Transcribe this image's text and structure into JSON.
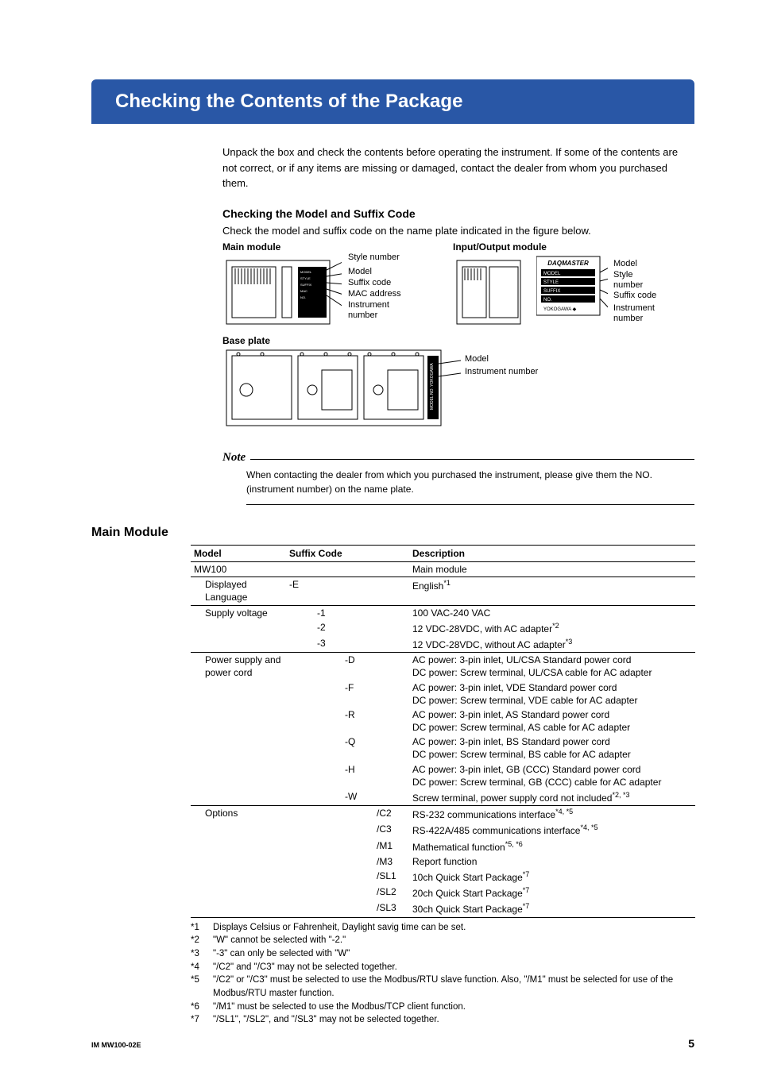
{
  "title": "Checking the Contents of the Package",
  "intro": "Unpack the box and check the contents before operating the instrument. If some of the contents are not correct, or if any items are missing or damaged, contact the dealer from whom you purchased them.",
  "subhead": "Checking the Model and Suffix Code",
  "subhead_text": "Check the model and suffix code on the name plate indicated in the figure below.",
  "figure": {
    "main_label": "Main module",
    "io_label": "Input/Output module",
    "base_label": "Base plate",
    "callouts_main": {
      "style_number": "Style number",
      "model": "Model",
      "suffix_code": "Suffix code",
      "mac": "MAC address",
      "inst_no": "Instrument number"
    },
    "callouts_io": {
      "model": "Model",
      "style_number": "Style number",
      "suffix_code": "Suffix code",
      "inst_no": "Instrument number"
    },
    "callouts_base": {
      "model": "Model",
      "inst_no": "Instrument number"
    },
    "daqmaster": "DAQMASTER",
    "yokogawa": "YOKOGAWA",
    "plate_labels": [
      "MODEL",
      "STYLE",
      "SUFFIX",
      "NO."
    ]
  },
  "note_label": "Note",
  "note_text": "When contacting the dealer from which you purchased the instrument, please give them the NO. (instrument number) on the name plate.",
  "section_head": "Main Module",
  "table_headers": {
    "model": "Model",
    "suffix": "Suffix Code",
    "desc": "Description"
  },
  "table": {
    "r1_model": "MW100",
    "r1_desc": "Main module",
    "r2_model": "Displayed Language",
    "r2_code": "-E",
    "r2_desc": "English",
    "r2_sup": "*1",
    "r3_model": "Supply voltage",
    "r3_code": "-1",
    "r3_desc": "100 VAC-240 VAC",
    "r4_code": "-2",
    "r4_desc": "12 VDC-28VDC, with AC adapter",
    "r4_sup": "*2",
    "r5_code": "-3",
    "r5_desc": "12 VDC-28VDC, without AC adapter",
    "r5_sup": "*3",
    "r6_model": "Power supply and power cord",
    "r6_code": "-D",
    "r6_desc": "AC power: 3-pin inlet, UL/CSA Standard power cord\nDC power: Screw terminal, UL/CSA cable for AC adapter",
    "r7_code": "-F",
    "r7_desc": "AC power: 3-pin inlet, VDE Standard power cord\nDC power: Screw terminal, VDE cable for AC adapter",
    "r8_code": "-R",
    "r8_desc": "AC power: 3-pin inlet, AS  Standard power cord\nDC power: Screw terminal, AS cable for AC adapter",
    "r9_code": "-Q",
    "r9_desc": "AC power: 3-pin inlet, BS Standard power cord\nDC power: Screw terminal, BS cable for AC adapter",
    "r10_code": "-H",
    "r10_desc": "AC power: 3-pin inlet, GB (CCC) Standard power cord\nDC power: Screw terminal, GB (CCC) cable for AC adapter",
    "r11_code": "-W",
    "r11_desc": "Screw terminal, power supply cord not included",
    "r11_sup": "*2, *3",
    "r12_model": "Options",
    "r12_code": "/C2",
    "r12_desc": "RS-232 communications interface",
    "r12_sup": "*4, *5",
    "r13_code": "/C3",
    "r13_desc": "RS-422A/485 communications interface",
    "r13_sup": "*4, *5",
    "r14_code": "/M1",
    "r14_desc": "Mathematical function",
    "r14_sup": "*5, *6",
    "r15_code": "/M3",
    "r15_desc": "Report function",
    "r16_code": "/SL1",
    "r16_desc": "10ch Quick Start Package",
    "r16_sup": "*7",
    "r17_code": "/SL2",
    "r17_desc": "20ch Quick Start Package",
    "r17_sup": "*7",
    "r18_code": "/SL3",
    "r18_desc": "30ch Quick Start Package",
    "r18_sup": "*7"
  },
  "footnotes": {
    "f1_n": "*1",
    "f1": "Displays Celsius or Fahrenheit, Daylight savig time can be set.",
    "f2_n": "*2",
    "f2": "\"W\" cannot be selected with \"-2.\"",
    "f3_n": "*3",
    "f3": "\"-3\" can only be selected with \"W\"",
    "f4_n": "*4",
    "f4": "\"/C2\" and \"/C3\" may not be selected together.",
    "f5_n": "*5",
    "f5": "\"/C2\" or \"/C3\" must be selected to use the Modbus/RTU slave function. Also, \"/M1\" must be selected for use of the Modbus/RTU master function.",
    "f6_n": "*6",
    "f6": "\"/M1\" must be selected to use the Modbus/TCP client function.",
    "f7_n": "*7",
    "f7": "\"/SL1\", \"/SL2\", and \"/SL3\" may not be selected together."
  },
  "footer": {
    "doc_id": "IM MW100-02E",
    "page": "5"
  }
}
